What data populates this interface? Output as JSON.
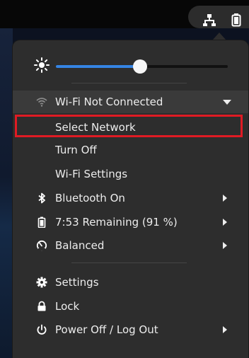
{
  "colors": {
    "accent": "#3584e4",
    "menu_bg": "#2d2d2d",
    "highlight_border": "#e01b24"
  },
  "tray": {
    "network_icon": "network-wired-icon",
    "battery_icon": "battery-icon"
  },
  "brightness": {
    "icon": "brightness-sun-icon",
    "level": 0.49
  },
  "wifi": {
    "header_label": "Wi-Fi Not Connected",
    "icon": "wifi-icon",
    "items": [
      {
        "label": "Select Network"
      },
      {
        "label": "Turn Off"
      },
      {
        "label": "Wi-Fi Settings"
      }
    ]
  },
  "menu_items": {
    "bluetooth": {
      "label": "Bluetooth On",
      "icon": "bluetooth-icon"
    },
    "battery": {
      "label": "7:53 Remaining (91 %)",
      "icon": "battery-icon"
    },
    "power_mode": {
      "label": "Balanced",
      "icon": "power-mode-icon"
    },
    "settings": {
      "label": "Settings",
      "icon": "gear-icon"
    },
    "lock": {
      "label": "Lock",
      "icon": "lock-icon"
    },
    "power": {
      "label": "Power Off / Log Out",
      "icon": "power-icon"
    }
  }
}
